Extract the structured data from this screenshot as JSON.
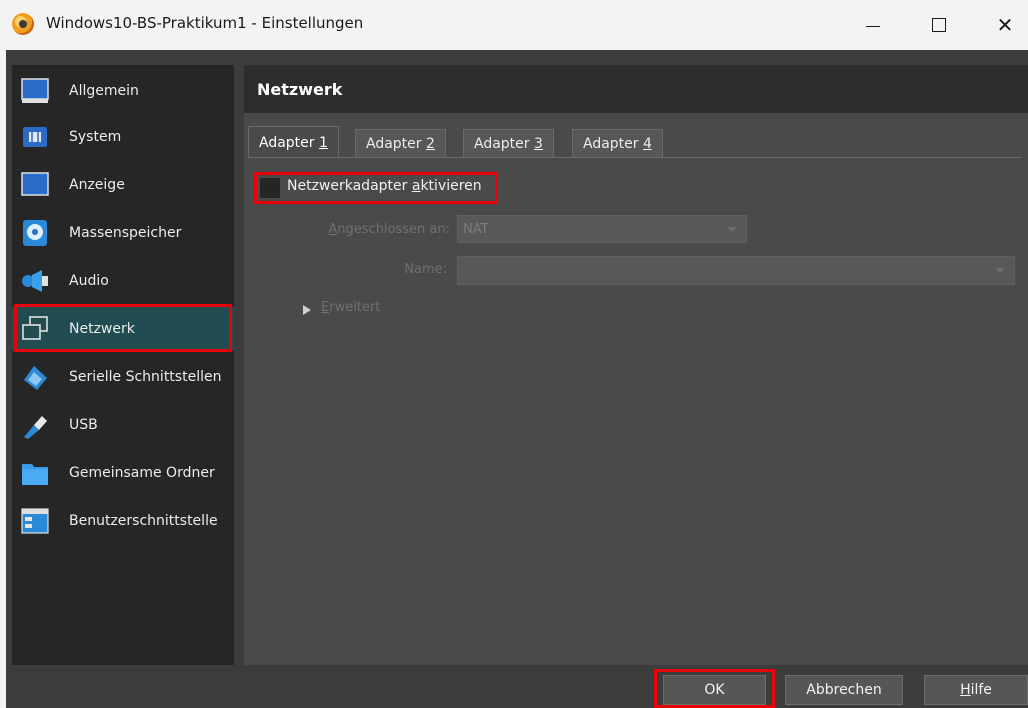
{
  "window": {
    "title": "Windows10-BS-Praktikum1 - Einstellungen",
    "minimize_glyph": "—",
    "maximize_glyph": "☐",
    "close_glyph": "✕"
  },
  "sidebar": {
    "items": [
      {
        "label": "Allgemein",
        "icon": "general-monitor-icon"
      },
      {
        "label": "System",
        "icon": "chip-icon"
      },
      {
        "label": "Anzeige",
        "icon": "display-icon"
      },
      {
        "label": "Massenspeicher",
        "icon": "storage-disk-icon"
      },
      {
        "label": "Audio",
        "icon": "speaker-icon"
      },
      {
        "label": "Netzwerk",
        "icon": "network-icon",
        "selected": true
      },
      {
        "label": "Serielle Schnittstellen",
        "icon": "serial-port-icon"
      },
      {
        "label": "USB",
        "icon": "usb-icon"
      },
      {
        "label": "Gemeinsame Ordner",
        "icon": "folder-icon"
      },
      {
        "label": "Benutzerschnittstelle",
        "icon": "user-interface-icon"
      }
    ]
  },
  "content": {
    "title": "Netzwerk",
    "tabs": [
      {
        "prefix": "Adapter ",
        "key": "1"
      },
      {
        "prefix": "Adapter ",
        "key": "2"
      },
      {
        "prefix": "Adapter ",
        "key": "3"
      },
      {
        "prefix": "Adapter ",
        "key": "4"
      }
    ],
    "enable_checkbox": {
      "prefix": "Netzwerkadapter ",
      "key": "a",
      "rest": "ktivieren",
      "checked": false
    },
    "attached_to": {
      "key": "A",
      "label_rest": "ngeschlossen an:",
      "value": "NAT"
    },
    "name_field": {
      "label": "Name:",
      "value": ""
    },
    "advanced": {
      "key": "E",
      "rest": "rweitert"
    }
  },
  "buttons": {
    "ok": "OK",
    "cancel": "Abbrechen",
    "help_key": "H",
    "help_rest": "ilfe"
  },
  "colors": {
    "highlight": "#e8000b",
    "selected_item": "#204c52"
  }
}
